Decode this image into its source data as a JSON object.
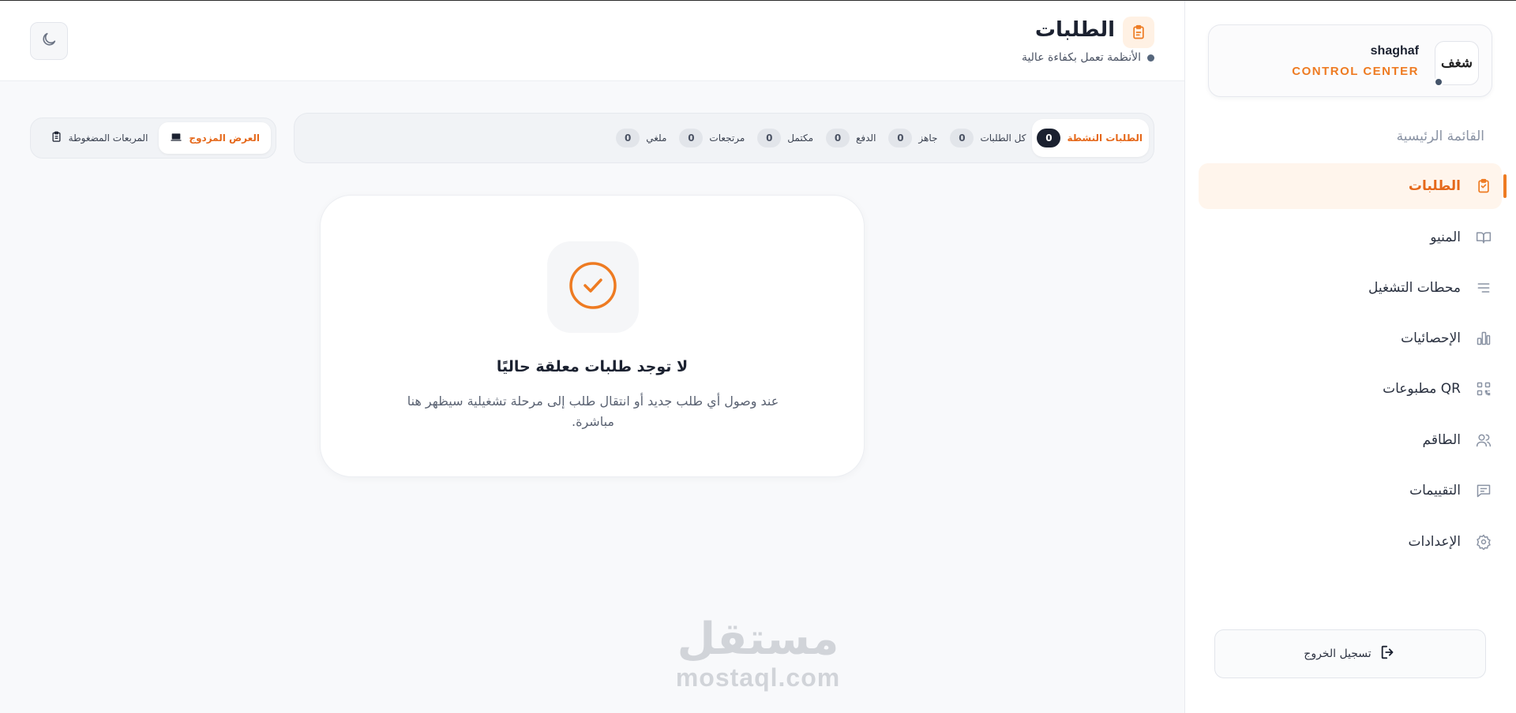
{
  "brand": {
    "name": "shaghaf",
    "subtitle": "CONTROL CENTER",
    "logo_text": "شغف"
  },
  "sidebar": {
    "heading": "القائمة الرئيسية",
    "items": [
      {
        "label": "الطلبات",
        "icon": "clipboard-icon",
        "active": true
      },
      {
        "label": "المنيو",
        "icon": "book-open-icon",
        "active": false
      },
      {
        "label": "محطات التشغيل",
        "icon": "list-lines-icon",
        "active": false
      },
      {
        "label": "الإحصائيات",
        "icon": "bar-chart-icon",
        "active": false
      },
      {
        "label": "مطبوعات QR",
        "icon": "qr-code-icon",
        "active": false
      },
      {
        "label": "الطاقم",
        "icon": "users-icon",
        "active": false
      },
      {
        "label": "التقييمات",
        "icon": "message-square-icon",
        "active": false
      },
      {
        "label": "الإعدادات",
        "icon": "gear-icon",
        "active": false
      }
    ],
    "logout_label": "تسجيل الخروج"
  },
  "header": {
    "title": "الطلبات",
    "status": "الأنظمة تعمل بكفاءة عالية"
  },
  "filters": [
    {
      "label": "الطلبات النشطة",
      "count": "0",
      "active": true
    },
    {
      "label": "كل الطلبات",
      "count": "0",
      "active": false
    },
    {
      "label": "جاهز",
      "count": "0",
      "active": false
    },
    {
      "label": "الدفع",
      "count": "0",
      "active": false
    },
    {
      "label": "مكتمل",
      "count": "0",
      "active": false
    },
    {
      "label": "مرتجعات",
      "count": "0",
      "active": false
    },
    {
      "label": "ملغي",
      "count": "0",
      "active": false
    }
  ],
  "view_toggle": {
    "dual": "العرض المزدوج",
    "compact": "المربعات المضغوطة"
  },
  "empty_state": {
    "title": "لا توجد طلبات معلقة حاليًا",
    "description": "عند وصول أي طلب جديد أو انتقال طلب إلى مرحلة تشغيلية سيظهر هنا مباشرة."
  },
  "watermark": {
    "arabic": "مستقل",
    "latin": "mostaql.com"
  },
  "colors": {
    "accent": "#ee7b22",
    "accent_text": "#e5681a",
    "dark": "#1b2130",
    "bg": "#f8f9fb"
  }
}
